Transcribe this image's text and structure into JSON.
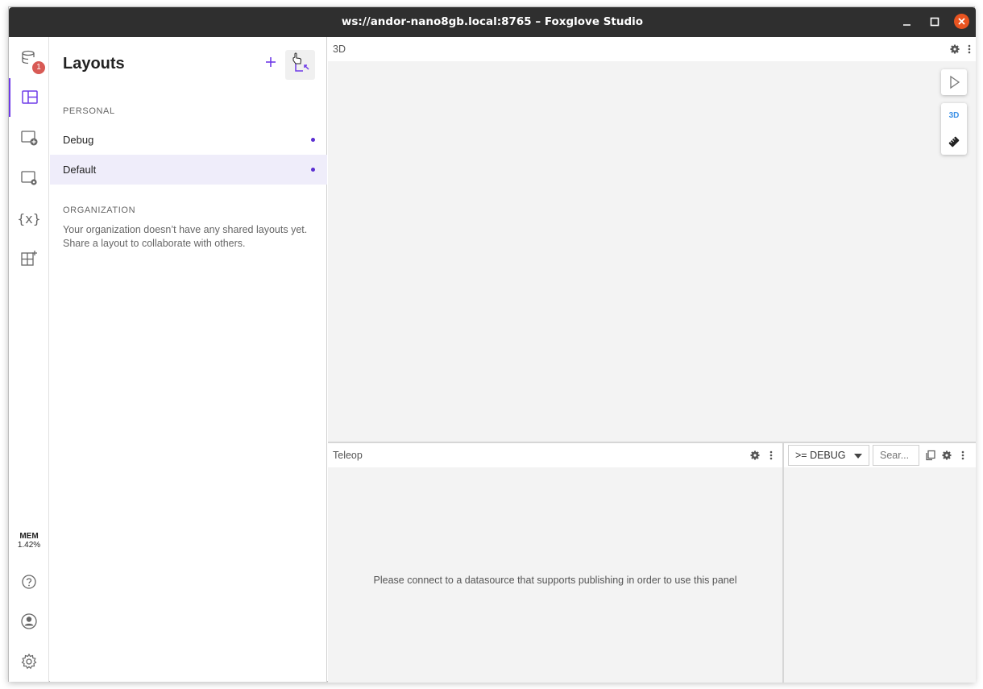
{
  "window": {
    "title": "ws://andor-nano8gb.local:8765 – Foxglove Studio"
  },
  "sidebar": {
    "badge_count": "1",
    "mem_label": "MEM",
    "mem_value": "1.42%",
    "items": [
      {
        "icon": "data-source-icon"
      },
      {
        "icon": "layouts-icon",
        "active": true
      },
      {
        "icon": "add-panel-icon"
      },
      {
        "icon": "panel-settings-icon"
      },
      {
        "icon": "variables-icon",
        "glyph": "{x}"
      },
      {
        "icon": "extensions-icon"
      },
      {
        "icon": "help-icon"
      },
      {
        "icon": "account-icon"
      },
      {
        "icon": "settings-icon"
      }
    ]
  },
  "layouts": {
    "title": "Layouts",
    "personal_label": "PERSONAL",
    "items": [
      {
        "name": "Debug",
        "selected": false
      },
      {
        "name": "Default",
        "selected": true
      }
    ],
    "organization_label": "ORGANIZATION",
    "organization_message": "Your organization doesn’t have any shared layouts yet. Share a layout to collaborate with others."
  },
  "panels": {
    "three_d": {
      "title": "3D",
      "toolbox_label": "3D"
    },
    "teleop": {
      "title": "Teleop",
      "message": "Please connect to a datasource that supports publishing in order to use this panel"
    },
    "log": {
      "level_value": ">= DEBUG",
      "search_placeholder": "Sear..."
    }
  },
  "colors": {
    "accent": "#6f3be8",
    "titlebar": "#2f2f2f",
    "close_button": "#e95420",
    "badge": "#d85a55",
    "selected_row": "#efedfa",
    "three_d_badge": "#3b90e6"
  }
}
